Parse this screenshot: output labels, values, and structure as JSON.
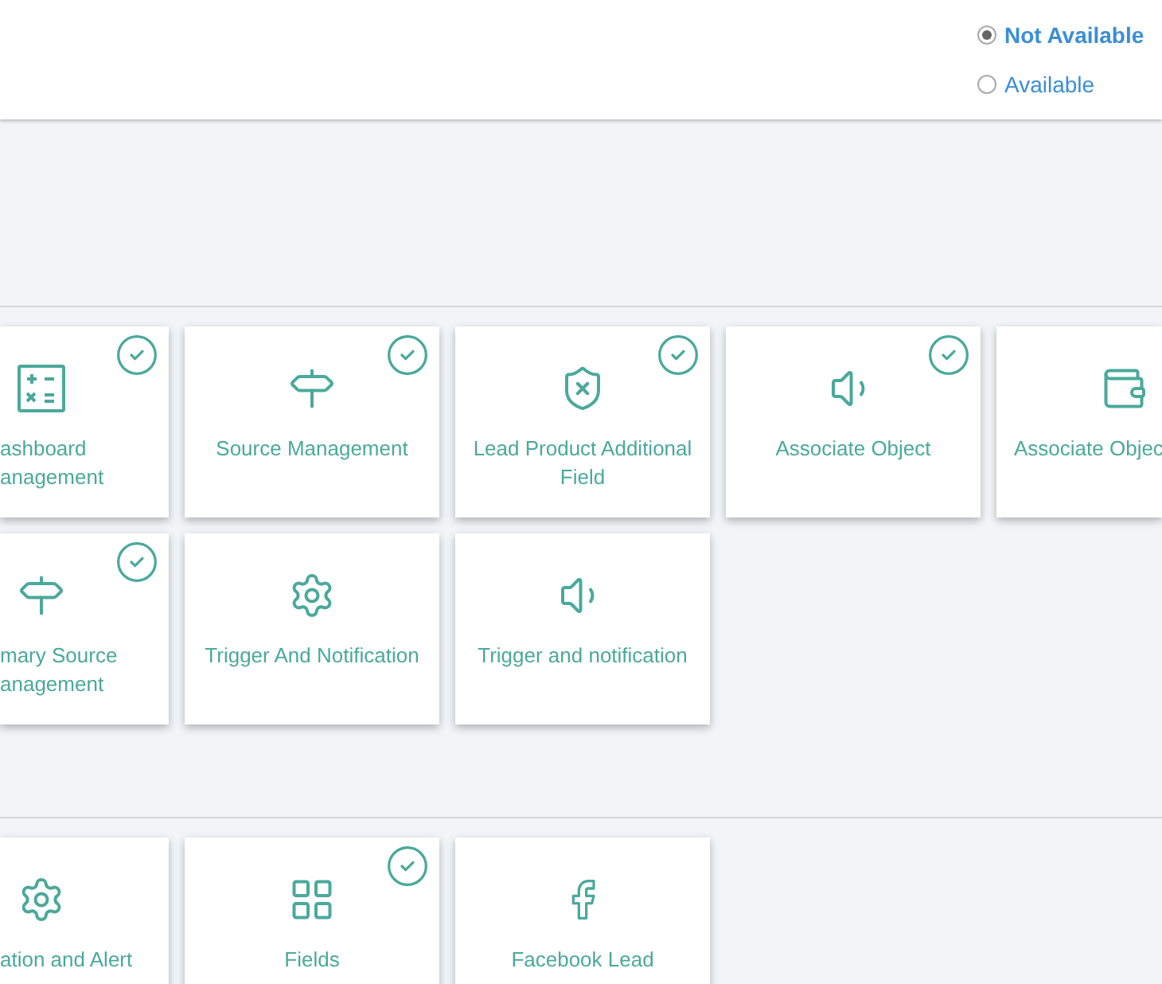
{
  "availability": [
    {
      "label": "Not Available",
      "selected": true
    },
    {
      "label": "Available",
      "selected": false
    }
  ],
  "sections": [
    {
      "rows": [
        {
          "cards": [
            {
              "kind": "calculator",
              "label": "ashboard\nanagement",
              "checked": true
            },
            {
              "kind": "signpost",
              "label": "Source Management",
              "checked": true
            },
            {
              "kind": "shield",
              "label": "Lead Product Additional Field",
              "checked": true
            },
            {
              "kind": "speaker",
              "label": "Associate Object",
              "checked": true
            },
            {
              "kind": "wallet",
              "label": "Associate Objec",
              "checked": false
            }
          ]
        },
        {
          "cards": [
            {
              "kind": "signpost",
              "label": "mary Source\nanagement",
              "checked": true
            },
            {
              "kind": "gear",
              "label": "Trigger And Notification",
              "checked": false
            },
            {
              "kind": "speaker",
              "label": "Trigger and notification",
              "checked": false
            }
          ]
        }
      ]
    },
    {
      "rows": [
        {
          "cards": [
            {
              "kind": "gear",
              "label": "ation and Alert",
              "checked": false
            },
            {
              "kind": "grid",
              "label": "Fields",
              "checked": true
            },
            {
              "kind": "facebook",
              "label": "Facebook Lead",
              "checked": false
            }
          ]
        }
      ]
    }
  ]
}
